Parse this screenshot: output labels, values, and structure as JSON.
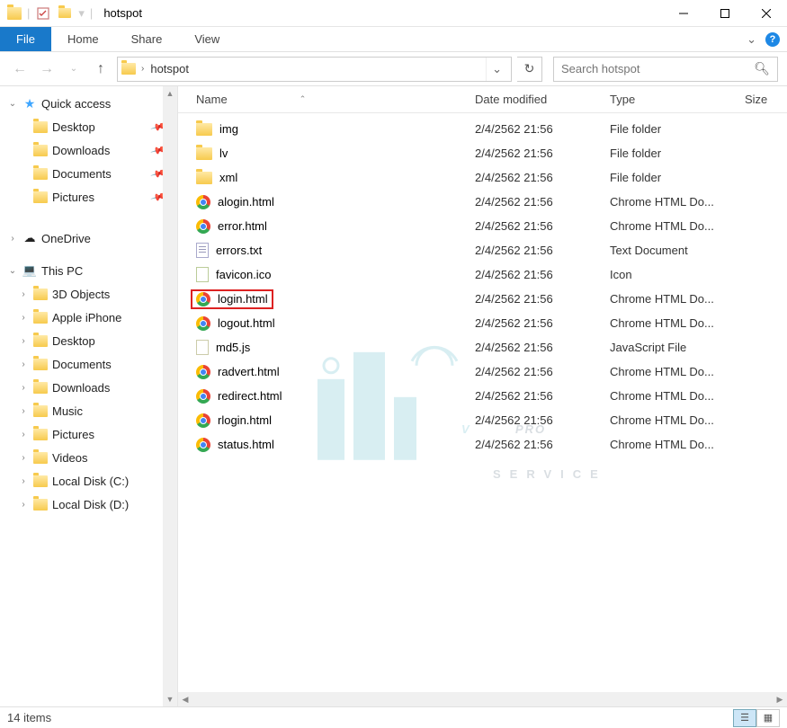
{
  "window": {
    "title": "hotspot"
  },
  "ribbon": {
    "file": "File",
    "tabs": [
      "Home",
      "Share",
      "View"
    ]
  },
  "address": {
    "crumb": "hotspot",
    "search_placeholder": "Search hotspot"
  },
  "sidebar": {
    "quick_access": "Quick access",
    "quick_items": [
      {
        "label": "Desktop",
        "pinned": true
      },
      {
        "label": "Downloads",
        "pinned": true
      },
      {
        "label": "Documents",
        "pinned": true
      },
      {
        "label": "Pictures",
        "pinned": true
      }
    ],
    "onedrive": "OneDrive",
    "this_pc": "This PC",
    "pc_items": [
      {
        "label": "3D Objects"
      },
      {
        "label": "Apple iPhone"
      },
      {
        "label": "Desktop"
      },
      {
        "label": "Documents"
      },
      {
        "label": "Downloads"
      },
      {
        "label": "Music"
      },
      {
        "label": "Pictures"
      },
      {
        "label": "Videos"
      },
      {
        "label": "Local Disk (C:)"
      },
      {
        "label": "Local Disk (D:)"
      }
    ]
  },
  "columns": {
    "name": "Name",
    "date": "Date modified",
    "type": "Type",
    "size": "Size"
  },
  "files": [
    {
      "name": "img",
      "date": "2/4/2562 21:56",
      "type": "File folder",
      "icon": "folder"
    },
    {
      "name": "lv",
      "date": "2/4/2562 21:56",
      "type": "File folder",
      "icon": "folder"
    },
    {
      "name": "xml",
      "date": "2/4/2562 21:56",
      "type": "File folder",
      "icon": "folder"
    },
    {
      "name": "alogin.html",
      "date": "2/4/2562 21:56",
      "type": "Chrome HTML Do...",
      "icon": "chrome"
    },
    {
      "name": "error.html",
      "date": "2/4/2562 21:56",
      "type": "Chrome HTML Do...",
      "icon": "chrome"
    },
    {
      "name": "errors.txt",
      "date": "2/4/2562 21:56",
      "type": "Text Document",
      "icon": "txt"
    },
    {
      "name": "favicon.ico",
      "date": "2/4/2562 21:56",
      "type": "Icon",
      "icon": "ico"
    },
    {
      "name": "login.html",
      "date": "2/4/2562 21:56",
      "type": "Chrome HTML Do...",
      "icon": "chrome",
      "highlight": true
    },
    {
      "name": "logout.html",
      "date": "2/4/2562 21:56",
      "type": "Chrome HTML Do...",
      "icon": "chrome"
    },
    {
      "name": "md5.js",
      "date": "2/4/2562 21:56",
      "type": "JavaScript File",
      "icon": "js"
    },
    {
      "name": "radvert.html",
      "date": "2/4/2562 21:56",
      "type": "Chrome HTML Do...",
      "icon": "chrome"
    },
    {
      "name": "redirect.html",
      "date": "2/4/2562 21:56",
      "type": "Chrome HTML Do...",
      "icon": "chrome"
    },
    {
      "name": "rlogin.html",
      "date": "2/4/2562 21:56",
      "type": "Chrome HTML Do...",
      "icon": "chrome"
    },
    {
      "name": "status.html",
      "date": "2/4/2562 21:56",
      "type": "Chrome HTML Do...",
      "icon": "chrome"
    }
  ],
  "status": {
    "count": "14 items"
  },
  "watermark": {
    "brand": "V-PRO",
    "sub": "SERVICE"
  }
}
